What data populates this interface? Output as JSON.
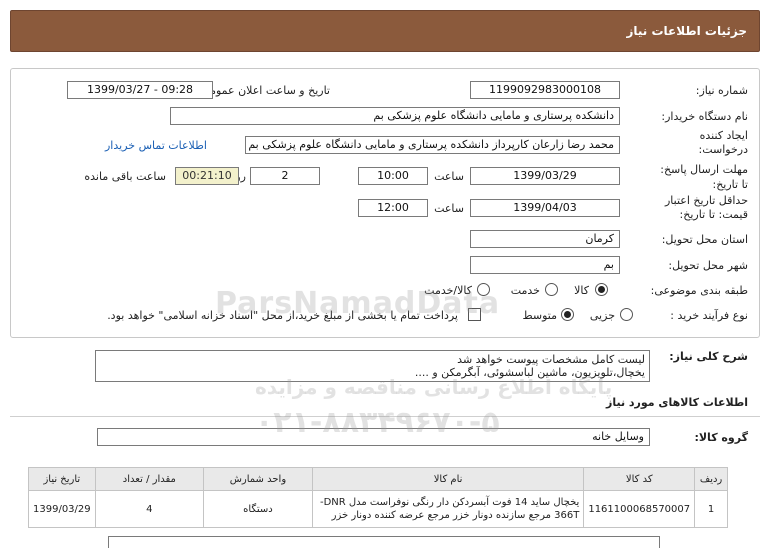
{
  "header": {
    "title": "جزئیات اطلاعات نیاز"
  },
  "fields": {
    "need_number_label": "شماره نیاز:",
    "need_number": "1199092983000108",
    "announce_label": "تاریخ و ساعت اعلان عمومی:",
    "announce_value": "1399/03/27 - 09:28",
    "buyer_label": "نام دستگاه خریدار:",
    "buyer_value": "دانشکده پرستاری و مامایی دانشگاه علوم پزشکی بم",
    "creator_label_1": "ایجاد کننده",
    "creator_label_2": "درخواست:",
    "creator_value": "محمد رضا  زارعان  کارپرداز دانشکده پرستاری و مامایی دانشگاه علوم پزشکی بم",
    "contact_link": "اطلاعات تماس خریدار",
    "deadline_label_1": "مهلت ارسال پاسخ:",
    "deadline_label_2": "تا تاریخ:",
    "deadline_date": "1399/03/29",
    "time_label": "ساعت",
    "deadline_time": "10:00",
    "days_value": "2",
    "days_label": "روز و",
    "remaining_time": "00:21:10",
    "remaining_label": "ساعت باقی مانده",
    "validity_label_1": "حداقل تاریخ اعتبار",
    "validity_label_2": "قیمت: تا تاریخ:",
    "validity_date": "1399/04/03",
    "validity_time": "12:00",
    "province_label": "استان محل تحویل:",
    "province_value": "کرمان",
    "city_label": "شهر محل تحویل:",
    "city_value": "بم",
    "category_label": "طبقه بندی موضوعی:",
    "category_options": [
      "کالا",
      "خدمت",
      "کالا/خدمت"
    ],
    "process_label": "نوع فرآیند خرید :",
    "process_options": [
      "جزیی",
      "متوسط"
    ],
    "payment_note": "پرداخت تمام یا بخشی از مبلغ خرید،از محل \"اسناد خزانه اسلامی\" خواهد بود."
  },
  "summary": {
    "label": "شرح کلی نیاز:",
    "line1": "لیست کامل مشخصات پیوست خواهد شد",
    "line2": "یخچال،تلویزیون، ماشین لباسشوئی، آبگرمکن و ...."
  },
  "goods_section": {
    "title": "اطلاعات کالاهای مورد نیاز",
    "group_label": "گروه کالا:",
    "group_value": "وسایل خانه"
  },
  "table": {
    "headers": [
      "ردیف",
      "کد کالا",
      "نام کالا",
      "واحد شمارش",
      "مقدار / تعداد",
      "تاریخ نیاز"
    ],
    "rows": [
      {
        "row": "1",
        "code": "1161100068570007",
        "name_line1": "یخچال ساید 14 فوت آبسردکن دار رنگی نوفراست مدل DNR-",
        "name_line2": "366T مرجع سازنده دونار خزر مرجع عرضه کننده دونار خزر",
        "unit": "دستگاه",
        "qty": "4",
        "date": "1399/03/29"
      }
    ]
  },
  "watermark": {
    "brand": "ParsNamadData",
    "line1": "پایگاه اطلاع رسانی مناقصه و مزایده",
    "phone": "۰۲۱-۸۸۳۴۹۶۷۰-۵"
  }
}
